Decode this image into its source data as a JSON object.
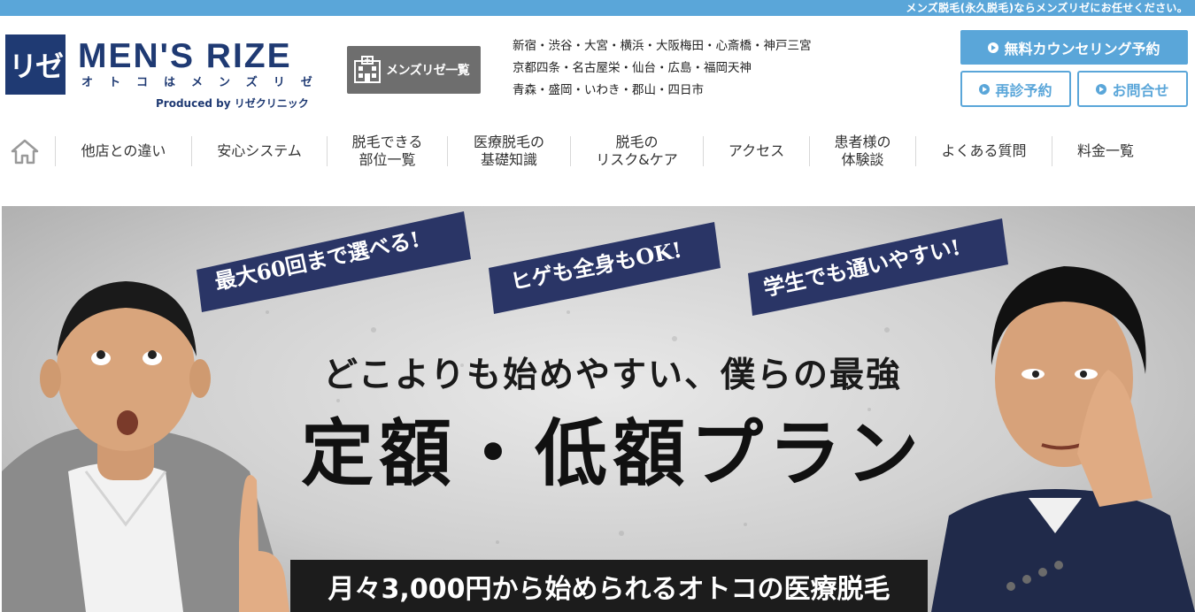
{
  "topbar": {
    "text": "メンズ脱毛(永久脱毛)ならメンズリゼにお任せください。"
  },
  "logo": {
    "mark": "リゼ",
    "brand": "MEN'S RIZE",
    "tagline": "オトコはメンズリゼ",
    "produced": "Produced by リゼクリニック"
  },
  "header": {
    "clinic_list_label": "メンズリゼ一覧",
    "locations": [
      "新宿・渋谷・大宮・横浜・大阪梅田・心斎橋・神戸三宮",
      "京都四条・名古屋栄・仙台・広島・福岡天神",
      "青森・盛岡・いわき・郡山・四日市"
    ],
    "cta_primary": "無料カウンセリング予約",
    "cta_revisit": "再診予約",
    "cta_contact": "お問合せ"
  },
  "nav": {
    "items": [
      {
        "label": "他店との違い"
      },
      {
        "label": "安心システム"
      },
      {
        "label": "脱毛できる\n部位一覧"
      },
      {
        "label": "医療脱毛の\n基礎知識"
      },
      {
        "label": "脱毛の\nリスク&ケア"
      },
      {
        "label": "アクセス"
      },
      {
        "label": "患者様の\n体験談"
      },
      {
        "label": "よくある質問"
      },
      {
        "label": "料金一覧"
      }
    ]
  },
  "hero": {
    "badges": [
      "最大60回まで選べる!",
      "ヒゲも全身もOK!",
      "学生でも通いやすい!"
    ],
    "headline": "どこよりも始めやすい、僕らの最強",
    "title": "定額・低額プラン",
    "band": "月々3,000円から始められるオトコの医療脱毛"
  },
  "colors": {
    "accent": "#5aa6d9",
    "brand_navy": "#1f3a73",
    "badge_navy": "#2a3566",
    "clinic_button": "#6e6e6e"
  }
}
